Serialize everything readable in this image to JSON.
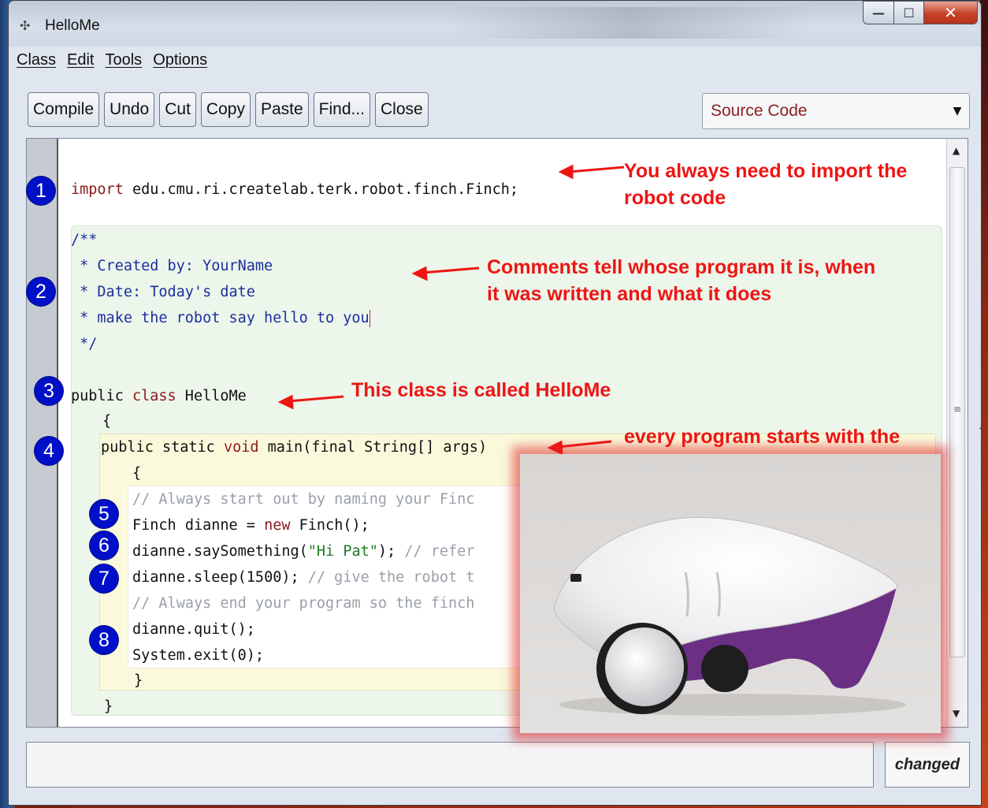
{
  "window": {
    "title": "HelloMe",
    "controls": {
      "minimize": "—",
      "maximize": "☐",
      "close": "✕"
    }
  },
  "menu": [
    "Class",
    "Edit",
    "Tools",
    "Options"
  ],
  "toolbar": [
    "Compile",
    "Undo",
    "Cut",
    "Copy",
    "Paste",
    "Find...",
    "Close"
  ],
  "view_select": {
    "value": "Source Code"
  },
  "code_lines": {
    "import": "import edu.cmu.ri.createlab.terk.robot.finch.Finch;",
    "c1": "/**",
    "c2": " * Created by: YourName",
    "c3": " * Date: Today's date",
    "c4": " * make the robot say hello to you",
    "c5": " */",
    "cls": "public class HelloMe",
    "ob1": "{",
    "main": "public static void main(final String[] args)",
    "ob2": "{",
    "l1": "// Always start out by naming your Finc",
    "l2": "Finch dianne = new Finch();",
    "l3": "dianne.saySomething(\"Hi Pat\"); // refer",
    "l4": "dianne.sleep(1500); // give the robot t",
    "l5": "// Always end your program so the finch",
    "l6": "dianne.quit();",
    "l7": "System.exit(0);",
    "cb2": "}",
    "cb1": "}"
  },
  "badges": [
    "1",
    "2",
    "3",
    "4",
    "5",
    "6",
    "7",
    "8"
  ],
  "annotations": {
    "a1": "You always need to import the robot code",
    "a2": "Comments tell whose program it is, when it was written and what it does",
    "a3": "This class is called HelloMe",
    "a4": "every program starts with the"
  },
  "status": {
    "message": "",
    "changed": "changed"
  },
  "colors": {
    "annotation": "#ee1515",
    "badge": "#0010c8",
    "keyword": "#8b1a1a",
    "comment": "#1c2fa0"
  }
}
